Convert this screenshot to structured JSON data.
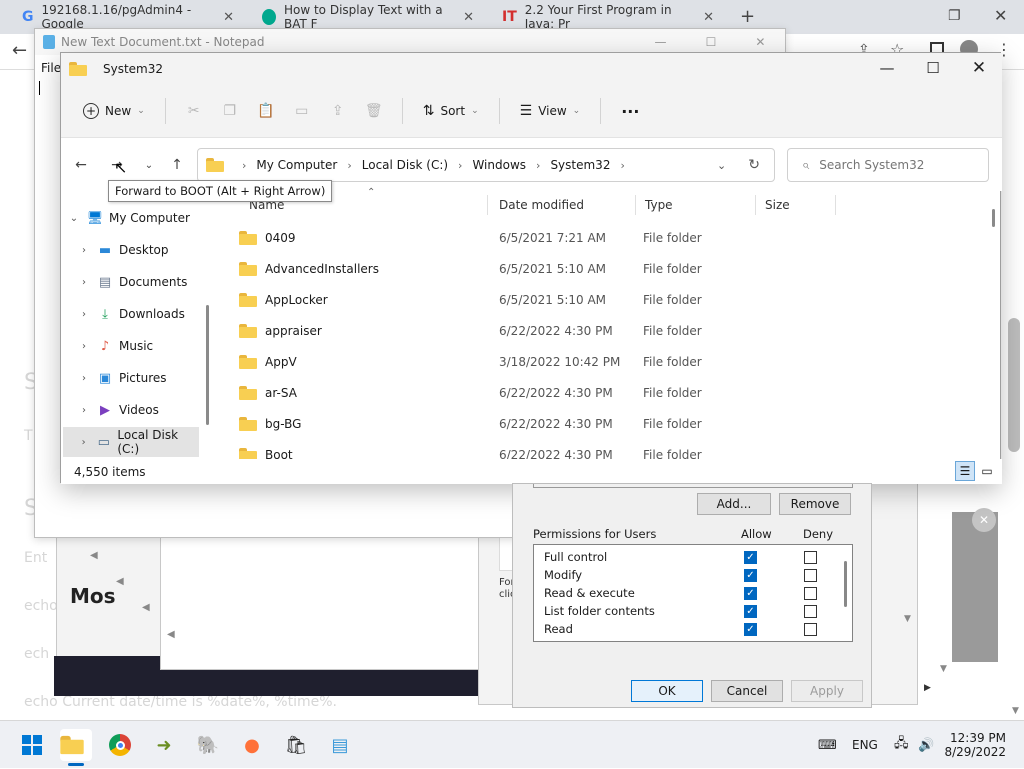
{
  "browser": {
    "tabs": [
      {
        "label": "192168.1.16/pgAdmin4 - Google",
        "fav": "google-g",
        "color": "#4285f4"
      },
      {
        "label": "How to Display Text with a BAT F",
        "fav": "page",
        "color": "#00a88e"
      },
      {
        "label": "2.2 Your First Program in Java: Pr",
        "fav": "it",
        "color": "#d32f2f"
      }
    ],
    "new_tab": "+",
    "page_lines": [
      "S",
      "T",
      "S",
      "Ent",
      "echo",
      "ech",
      "ech",
      "echo Current date/time is %date%, %time%."
    ],
    "page_heading": "Mos"
  },
  "notepad": {
    "title": "New Text Document.txt - Notepad",
    "menu": "File"
  },
  "explorer": {
    "title": "System32",
    "toolbar": {
      "new_label": "New",
      "sort_label": "Sort",
      "view_label": "View",
      "more": "···"
    },
    "breadcrumb": [
      "My Computer",
      "Local Disk (C:)",
      "Windows",
      "System32"
    ],
    "search_placeholder": "Search System32",
    "tooltip": "Forward to BOOT (Alt + Right Arrow)",
    "tree": [
      {
        "label": "My Computer",
        "icon": "computer-icon",
        "color": "#0078d4"
      },
      {
        "label": "Desktop",
        "icon": "desktop-icon",
        "color": "#2b88d8"
      },
      {
        "label": "Documents",
        "icon": "documents-icon",
        "color": "#6b7a8f"
      },
      {
        "label": "Downloads",
        "icon": "download-icon",
        "color": "#1e9e5a"
      },
      {
        "label": "Music",
        "icon": "music-icon",
        "color": "#e05a47"
      },
      {
        "label": "Pictures",
        "icon": "pictures-icon",
        "color": "#2b88d8"
      },
      {
        "label": "Videos",
        "icon": "videos-icon",
        "color": "#7b3fbf"
      },
      {
        "label": "Local Disk (C:)",
        "icon": "drive-icon",
        "color": "#4a6b8a"
      }
    ],
    "columns": [
      "Name",
      "Date modified",
      "Type",
      "Size"
    ],
    "rows": [
      {
        "name": "0409",
        "date": "6/5/2021 7:21 AM",
        "type": "File folder"
      },
      {
        "name": "AdvancedInstallers",
        "date": "6/5/2021 5:10 AM",
        "type": "File folder"
      },
      {
        "name": "AppLocker",
        "date": "6/5/2021 5:10 AM",
        "type": "File folder"
      },
      {
        "name": "appraiser",
        "date": "6/22/2022 4:30 PM",
        "type": "File folder"
      },
      {
        "name": "AppV",
        "date": "3/18/2022 10:42 PM",
        "type": "File folder"
      },
      {
        "name": "ar-SA",
        "date": "6/22/2022 4:30 PM",
        "type": "File folder"
      },
      {
        "name": "bg-BG",
        "date": "6/22/2022 4:30 PM",
        "type": "File folder"
      },
      {
        "name": "Boot",
        "date": "6/22/2022 4:30 PM",
        "type": "File folder"
      }
    ],
    "status": "4,550 items"
  },
  "permissions": {
    "add_label": "Add...",
    "remove_label": "Remove",
    "header": "Permissions for Users",
    "allow_label": "Allow",
    "deny_label": "Deny",
    "items": [
      {
        "label": "Full control",
        "allow": true,
        "deny": false
      },
      {
        "label": "Modify",
        "allow": true,
        "deny": false
      },
      {
        "label": "Read & execute",
        "allow": true,
        "deny": false
      },
      {
        "label": "List folder contents",
        "allow": true,
        "deny": false
      },
      {
        "label": "Read",
        "allow": true,
        "deny": false
      }
    ],
    "side_text": [
      "For",
      "clic"
    ],
    "ok_label": "OK",
    "cancel_label": "Cancel",
    "apply_label": "Apply"
  },
  "taskbar": {
    "apps": [
      "start-icon",
      "file-explorer-icon",
      "chrome-icon",
      "app-arrow-icon",
      "pgadmin-icon",
      "firefox-icon",
      "store-icon",
      "notepad-icon"
    ],
    "lang": "ENG",
    "time": "12:39 PM",
    "date": "8/29/2022"
  }
}
